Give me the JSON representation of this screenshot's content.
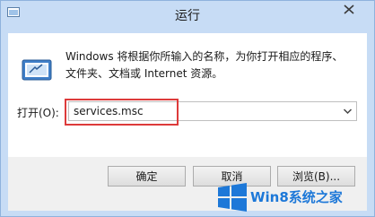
{
  "window": {
    "title": "运行"
  },
  "dialog": {
    "description_line1": "Windows 将根据你所输入的名称，为你打开相应的程序、",
    "description_line2": "文件夹、文档或 Internet 资源。",
    "open_label": "打开(O):",
    "open_value": "services.msc"
  },
  "buttons": {
    "ok": "确定",
    "cancel": "取消",
    "browse": "浏览(B)..."
  },
  "watermark": {
    "text": "Win8系统之家"
  },
  "colors": {
    "highlight_border": "#dd3b3b",
    "watermark_blue": "#1d78d8"
  }
}
